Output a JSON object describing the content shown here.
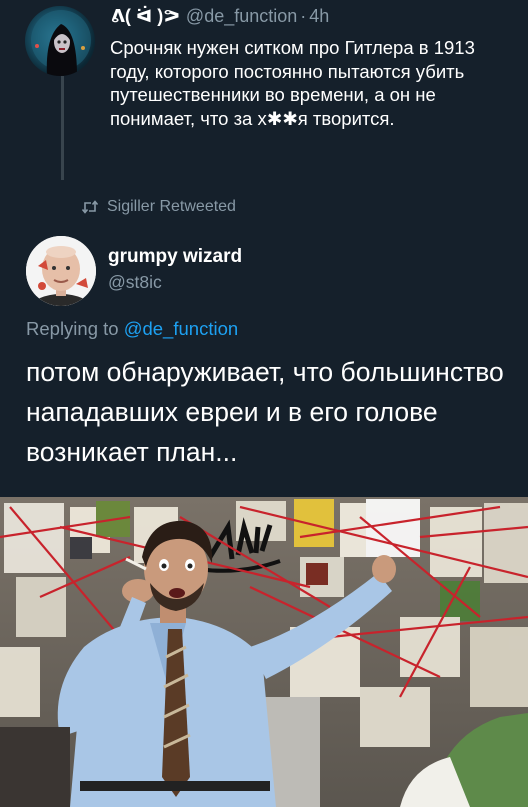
{
  "quoted_tweet": {
    "display_name": "ᕕ( ᐛ )ᕗ",
    "handle": "@de_function",
    "separator": "·",
    "time": "4h",
    "text": "Срочняк нужен ситком про Гитлера в 1913 году, которого постоянно пытаются убить путешественники во времени, а он не понимает, что за х✱✱я творится."
  },
  "retweet": {
    "text": "Sigiller Retweeted",
    "icon": "retweet-icon"
  },
  "main_tweet": {
    "display_name": "grumpy wizard",
    "handle": "@st8ic",
    "replying_prefix": "Replying to",
    "replying_handle": "@de_function",
    "text": "потом обнаруживает, что большинство нападавших евреи и в его голове возникает план..."
  },
  "colors": {
    "background": "#15202b",
    "secondary_text": "#8899a6",
    "link": "#1da1f2",
    "thread_line": "#38444d"
  }
}
